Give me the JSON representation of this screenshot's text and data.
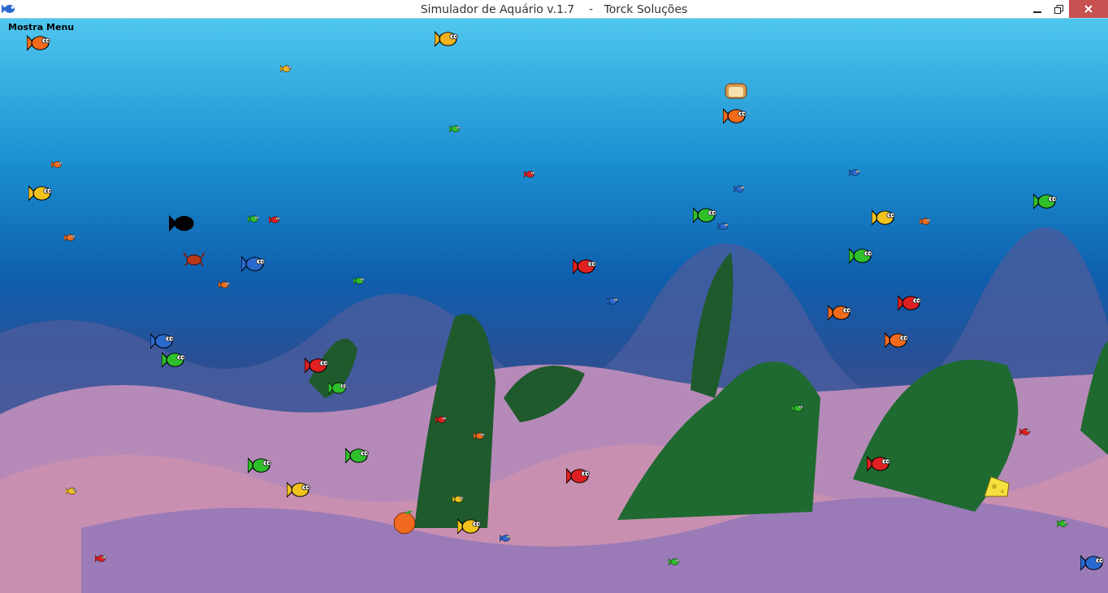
{
  "window": {
    "title": "Simulador de Aquário v.1.7    -   Torck Soluções"
  },
  "menu_toggle": {
    "label": "Mostra Menu"
  }
}
